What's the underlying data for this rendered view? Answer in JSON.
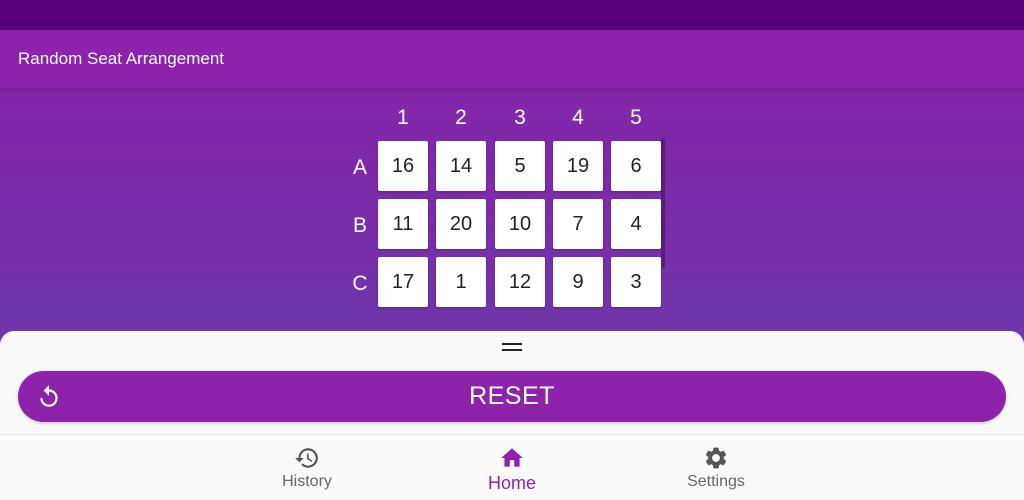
{
  "app": {
    "title": "Random Seat Arrangement"
  },
  "grid": {
    "columns": [
      "1",
      "2",
      "3",
      "4",
      "5"
    ],
    "rows": [
      {
        "label": "A",
        "seats": [
          "16",
          "14",
          "5",
          "19",
          "6"
        ]
      },
      {
        "label": "B",
        "seats": [
          "11",
          "20",
          "10",
          "7",
          "4"
        ]
      },
      {
        "label": "C",
        "seats": [
          "17",
          "1",
          "12",
          "9",
          "3"
        ]
      }
    ]
  },
  "sheet": {
    "reset_label": "RESET",
    "reset_icon": "reset-icon"
  },
  "nav": {
    "items": [
      {
        "label": "History",
        "icon": "history-icon",
        "active": false
      },
      {
        "label": "Home",
        "icon": "home-icon",
        "active": true
      },
      {
        "label": "Settings",
        "icon": "gear-icon",
        "active": false
      }
    ]
  },
  "colors": {
    "primary": "#8d22ab",
    "status_bar": "#56007a",
    "seat_background": "#ffffff",
    "nav_inactive": "#666666"
  }
}
